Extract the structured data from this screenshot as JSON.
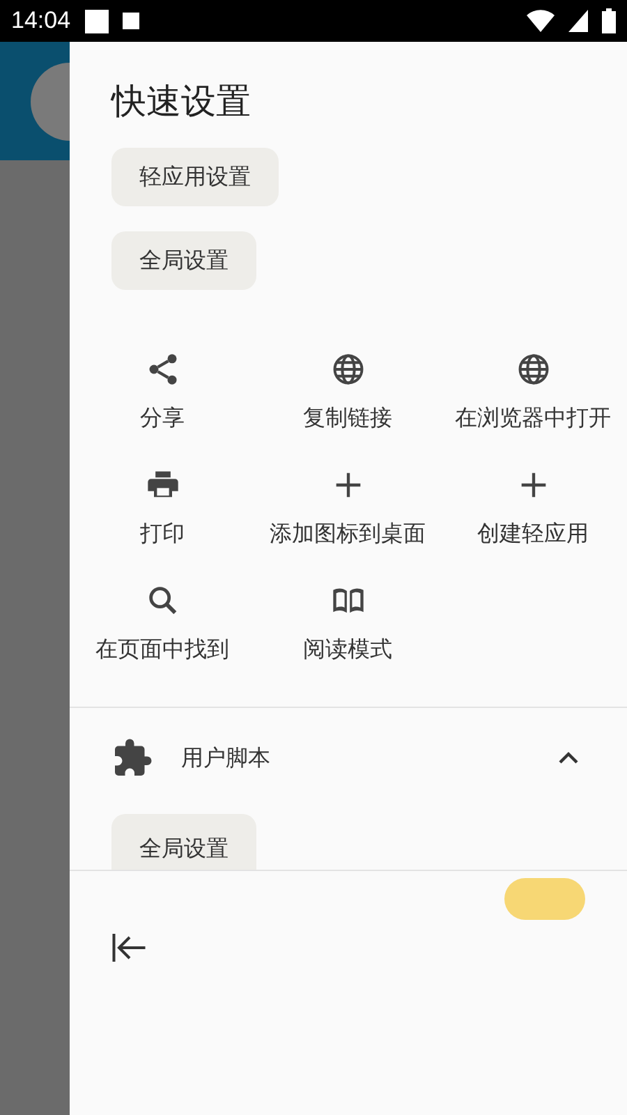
{
  "status_bar": {
    "time": "14:04"
  },
  "drawer": {
    "title": "快速设置",
    "chips": [
      "轻应用设置",
      "全局设置"
    ],
    "actions": [
      {
        "kind": "share",
        "label": "分享"
      },
      {
        "kind": "globe",
        "label": "复制链接"
      },
      {
        "kind": "globe",
        "label": "在浏览器中打开"
      },
      {
        "kind": "print",
        "label": "打印"
      },
      {
        "kind": "plus",
        "label": "添加图标到桌面"
      },
      {
        "kind": "plus",
        "label": "创建轻应用"
      },
      {
        "kind": "search",
        "label": "在页面中找到"
      },
      {
        "kind": "book",
        "label": "阅读模式"
      }
    ],
    "section": {
      "title": "用户脚本",
      "expanded": true,
      "chips": [
        "全局设置"
      ]
    }
  }
}
